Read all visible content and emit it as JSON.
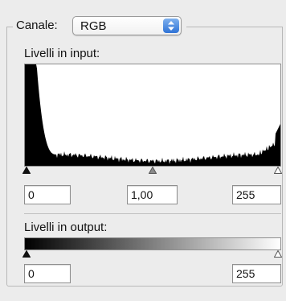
{
  "channel": {
    "label": "Canale:",
    "selected": "RGB"
  },
  "input_levels": {
    "label": "Livelli in input:",
    "black_value": "0",
    "gamma_value": "1,00",
    "white_value": "255"
  },
  "output_levels": {
    "label": "Livelli in output:",
    "black_value": "0",
    "white_value": "255"
  },
  "icons": {
    "select_arrows": "up-down-arrows-icon",
    "black_slider": "black-point-slider-icon",
    "gray_slider": "gamma-slider-icon",
    "white_slider": "white-point-slider-icon"
  },
  "colors": {
    "accent": "#2f73d6",
    "histogram": "#000000"
  }
}
